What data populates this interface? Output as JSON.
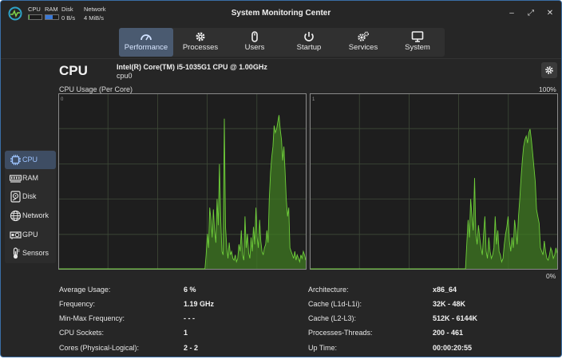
{
  "window": {
    "title": "System Monitoring Center",
    "minimize_glyph": "–",
    "maximize_glyph": "⤢",
    "close_glyph": "✕"
  },
  "headerbar": {
    "cpu_label": "CPU",
    "ram_label": "RAM",
    "disk_label": "Disk",
    "network_label": "Network",
    "disk_speed": "0 B/s",
    "network_speed": "4 MiB/s",
    "cpu_fraction": 0.06,
    "ram_fraction": 0.55
  },
  "tabs": [
    {
      "label": "Performance",
      "icon": "gauge-icon",
      "active": true
    },
    {
      "label": "Processes",
      "icon": "gear-icon",
      "active": false
    },
    {
      "label": "Users",
      "icon": "mouse-icon",
      "active": false
    },
    {
      "label": "Startup",
      "icon": "power-icon",
      "active": false
    },
    {
      "label": "Services",
      "icon": "gears-icon",
      "active": false
    },
    {
      "label": "System",
      "icon": "monitor-icon",
      "active": false
    }
  ],
  "sidebar": [
    {
      "label": "CPU",
      "icon": "cpu-chip-icon",
      "active": true
    },
    {
      "label": "RAM",
      "icon": "ram-icon",
      "active": false
    },
    {
      "label": "Disk",
      "icon": "disk-icon",
      "active": false
    },
    {
      "label": "Network",
      "icon": "globe-icon",
      "active": false
    },
    {
      "label": "GPU",
      "icon": "gpu-icon",
      "active": false
    },
    {
      "label": "Sensors",
      "icon": "thermometer-icon",
      "active": false
    }
  ],
  "cpu": {
    "heading": "CPU",
    "model": "Intel(R) Core(TM) i5-1035G1 CPU @ 1.00GHz",
    "device": "cpu0",
    "usage_title": "CPU Usage (Per Core)",
    "max_label": "100%",
    "min_label": "0%"
  },
  "chart_data": {
    "type": "area",
    "ylim": [
      0,
      100
    ],
    "grid": true,
    "colors": {
      "line": "#6fcf3a",
      "fill": "#3f7a22",
      "grid": "#3e4a38",
      "border": "#8a8a8a"
    },
    "series": [
      {
        "name": "0",
        "values": [
          0,
          0,
          0,
          0,
          0,
          0,
          0,
          0,
          0,
          0,
          0,
          0,
          0,
          0,
          0,
          0,
          0,
          0,
          0,
          0,
          0,
          0,
          0,
          0,
          0,
          0,
          0,
          0,
          0,
          0,
          0,
          0,
          0,
          0,
          0,
          0,
          0,
          0,
          0,
          0,
          0,
          0,
          0,
          0,
          0,
          0,
          0,
          0,
          0,
          0,
          0,
          0,
          0,
          0,
          0,
          0,
          0,
          0,
          0,
          0,
          0,
          0,
          0,
          0,
          0,
          0,
          0,
          0,
          0,
          0,
          0,
          0,
          0,
          0,
          0,
          0,
          0,
          0,
          0,
          0,
          0,
          0,
          0,
          0,
          0,
          0,
          0,
          0,
          0,
          0,
          0,
          0,
          0,
          0,
          0,
          0,
          0,
          0,
          0,
          0,
          0,
          0,
          0,
          0,
          0,
          0,
          0,
          0,
          0,
          0,
          0,
          0,
          0,
          0,
          0,
          0,
          0,
          0,
          0,
          0,
          0,
          8,
          20,
          12,
          35,
          28,
          18,
          34,
          22,
          15,
          40,
          25,
          60,
          30,
          10,
          8,
          86,
          24,
          12,
          6,
          15,
          8,
          10,
          6,
          5,
          8,
          4,
          6,
          14,
          10,
          22,
          8,
          5,
          30,
          12,
          20,
          9,
          6,
          18,
          10,
          24,
          14,
          35,
          18,
          12,
          28,
          16,
          10,
          8,
          12,
          14,
          22,
          15,
          40,
          55,
          64,
          70,
          82,
          78,
          80,
          84,
          88,
          80,
          74,
          62,
          70,
          56,
          40,
          30,
          35,
          12,
          10,
          8,
          6,
          10,
          5,
          8,
          6,
          4,
          8,
          6,
          10,
          8,
          5
        ]
      },
      {
        "name": "1",
        "values": [
          0,
          0,
          0,
          0,
          0,
          0,
          0,
          0,
          0,
          0,
          0,
          0,
          0,
          0,
          0,
          0,
          0,
          0,
          0,
          0,
          0,
          0,
          0,
          0,
          0,
          0,
          0,
          0,
          0,
          0,
          0,
          0,
          0,
          0,
          0,
          0,
          0,
          0,
          0,
          0,
          0,
          0,
          0,
          0,
          0,
          0,
          0,
          0,
          0,
          0,
          0,
          0,
          0,
          0,
          0,
          0,
          0,
          0,
          0,
          0,
          0,
          0,
          0,
          0,
          0,
          0,
          0,
          0,
          0,
          0,
          0,
          0,
          0,
          0,
          0,
          0,
          0,
          0,
          0,
          0,
          0,
          0,
          0,
          0,
          0,
          0,
          0,
          0,
          0,
          0,
          0,
          0,
          0,
          0,
          0,
          0,
          0,
          0,
          0,
          0,
          0,
          0,
          0,
          0,
          0,
          0,
          0,
          0,
          0,
          0,
          0,
          0,
          0,
          0,
          0,
          0,
          0,
          0,
          0,
          0,
          0,
          15,
          28,
          18,
          40,
          30,
          22,
          52,
          20,
          14,
          25,
          18,
          12,
          8,
          20,
          30,
          10,
          6,
          18,
          10,
          6,
          8,
          12,
          30,
          14,
          22,
          10,
          8,
          4,
          6,
          14,
          20,
          24,
          30,
          16,
          10,
          18,
          12,
          28,
          22,
          14,
          30,
          40,
          52,
          62,
          70,
          74,
          76,
          72,
          78,
          80,
          74,
          66,
          58,
          50,
          34,
          30,
          26,
          12,
          10,
          8,
          16,
          10,
          6,
          5,
          8,
          12,
          10,
          6,
          8,
          12,
          9
        ]
      }
    ]
  },
  "stats_left": [
    {
      "label": "Average Usage:",
      "value": "6 %"
    },
    {
      "label": "Frequency:",
      "value": "1.19 GHz"
    },
    {
      "label": "Min-Max Frequency:",
      "value": "- - -"
    },
    {
      "label": "CPU Sockets:",
      "value": "1"
    },
    {
      "label": "Cores (Physical-Logical):",
      "value": "2 - 2"
    }
  ],
  "stats_right": [
    {
      "label": "Architecture:",
      "value": "x86_64"
    },
    {
      "label": "Cache (L1d-L1i):",
      "value": "32K - 48K"
    },
    {
      "label": "Cache (L2-L3):",
      "value": "512K - 6144K"
    },
    {
      "label": "Processes-Threads:",
      "value": "200 - 461"
    },
    {
      "label": "Up Time:",
      "value": "00:00:20:55"
    }
  ]
}
